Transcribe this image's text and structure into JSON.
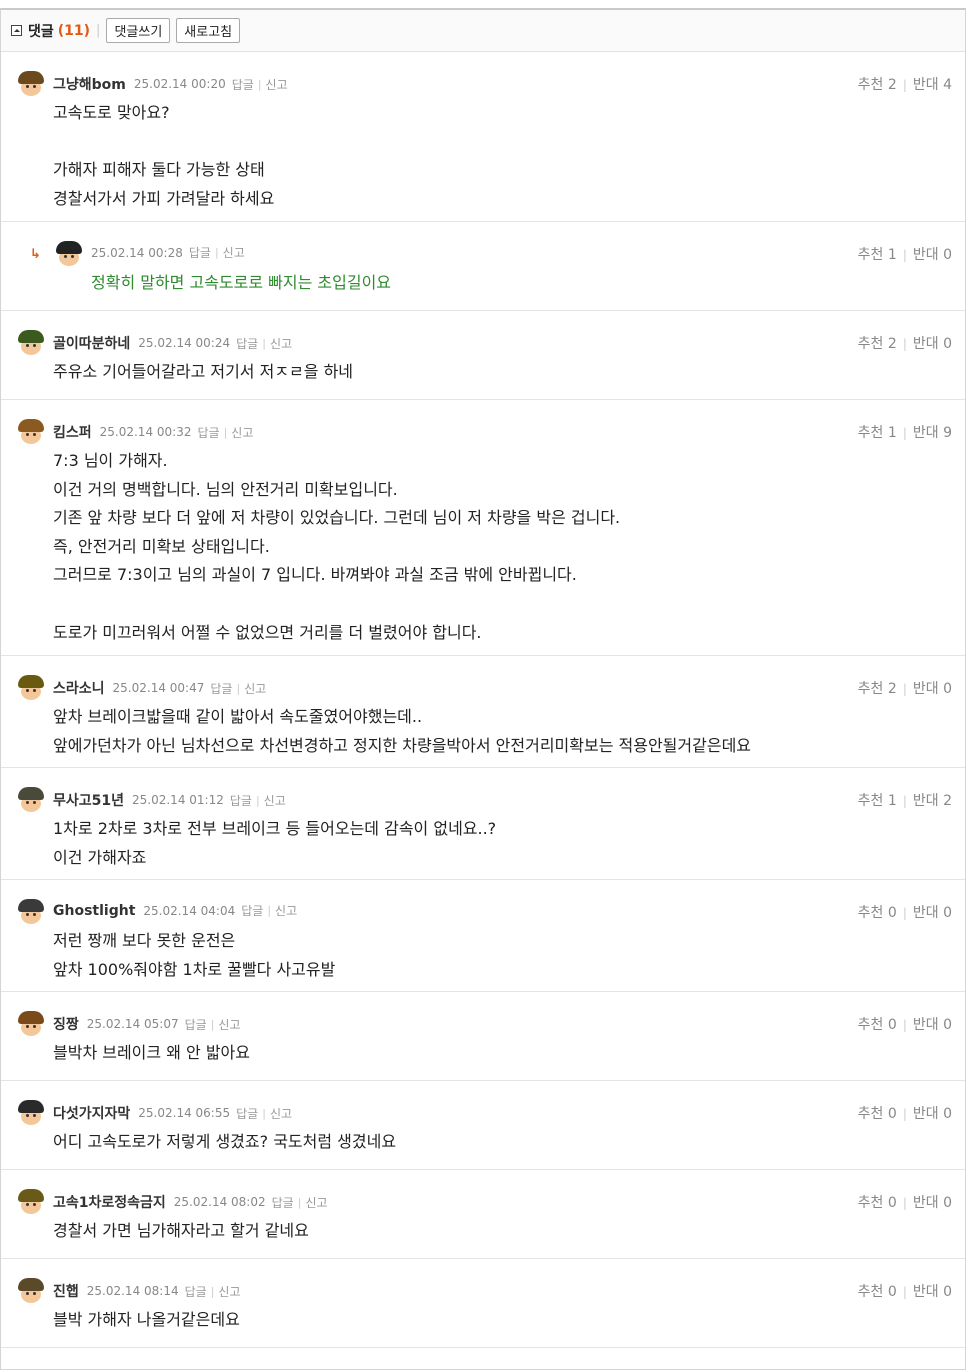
{
  "header": {
    "title": "댓글",
    "count": "(11)",
    "write_button": "댓글쓰기",
    "refresh_button": "새로고침"
  },
  "actions": {
    "reply": "답글",
    "report": "신고"
  },
  "vote_labels": {
    "up": "추천",
    "down": "반대"
  },
  "comments": [
    {
      "nick": "그냥해bom",
      "date": "25.02.14 00:20",
      "up": "2",
      "down": "4",
      "lines": [
        "고속도로 맞아요?",
        "",
        "가해자 피해자 둘다 가능한 상태",
        "경찰서가서 가피 가려달라 하세요"
      ]
    },
    {
      "nick": "",
      "date": "25.02.14 00:28",
      "up": "1",
      "down": "0",
      "reply": true,
      "lines": [
        "정확히 말하면 고속도로로 빠지는 초입길이요"
      ]
    },
    {
      "nick": "골이따분하네",
      "date": "25.02.14 00:24",
      "up": "2",
      "down": "0",
      "lines": [
        "주유소 기어들어갈라고 저기서 저ㅈㄹ을 하네"
      ]
    },
    {
      "nick": "킴스퍼",
      "date": "25.02.14 00:32",
      "up": "1",
      "down": "9",
      "lines": [
        "7:3 님이 가해자.",
        "이건 거의 명백합니다. 님의 안전거리 미확보입니다.",
        "기존 앞 차량 보다 더 앞에 저 차량이 있었습니다. 그런데 님이 저 차량을 박은 겁니다.",
        "즉, 안전거리 미확보 상태입니다.",
        "그러므로 7:3이고 님의 과실이 7 입니다. 바껴봐야 과실 조금 밖에 안바뀝니다.",
        "",
        "도로가 미끄러워서 어쩔 수 없었으면 거리를 더 벌렸어야 합니다."
      ]
    },
    {
      "nick": "스라소니",
      "date": "25.02.14 00:47",
      "up": "2",
      "down": "0",
      "lines": [
        "앞차 브레이크밟을때 같이 밟아서 속도줄였어야했는데..",
        "앞에가던차가 아닌 님차선으로 차선변경하고 정지한 차량을박아서 안전거리미확보는 적용안될거같은데요"
      ]
    },
    {
      "nick": "무사고51년",
      "date": "25.02.14 01:12",
      "up": "1",
      "down": "2",
      "lines": [
        "1차로 2차로 3차로 전부 브레이크 등 들어오는데 감속이 없네요..?",
        "이건 가해자죠"
      ]
    },
    {
      "nick": "Ghostlight",
      "date": "25.02.14 04:04",
      "up": "0",
      "down": "0",
      "lines": [
        "저런 짱깨 보다 못한 운전은",
        "앞차 100%줘야함 1차로 꿀빨다 사고유발"
      ]
    },
    {
      "nick": "징짱",
      "date": "25.02.14 05:07",
      "up": "0",
      "down": "0",
      "lines": [
        "블박차 브레이크 왜 안 밟아요"
      ]
    },
    {
      "nick": "다섯가지자막",
      "date": "25.02.14 06:55",
      "up": "0",
      "down": "0",
      "lines": [
        "어디 고속도로가 저렇게 생겼죠? 국도처럼 생겼네요"
      ]
    },
    {
      "nick": "고속1차로정속금지",
      "date": "25.02.14 08:02",
      "up": "0",
      "down": "0",
      "lines": [
        "경찰서 가면 님가해자라고 할거 같네요"
      ]
    },
    {
      "nick": "진햅",
      "date": "25.02.14 08:14",
      "up": "0",
      "down": "0",
      "lines": [
        "블박 가해자 나올거같은데요"
      ]
    }
  ],
  "colors": {
    "accent": "#e25b16",
    "reply_text": "#2e8b2e",
    "muted": "#888888"
  }
}
